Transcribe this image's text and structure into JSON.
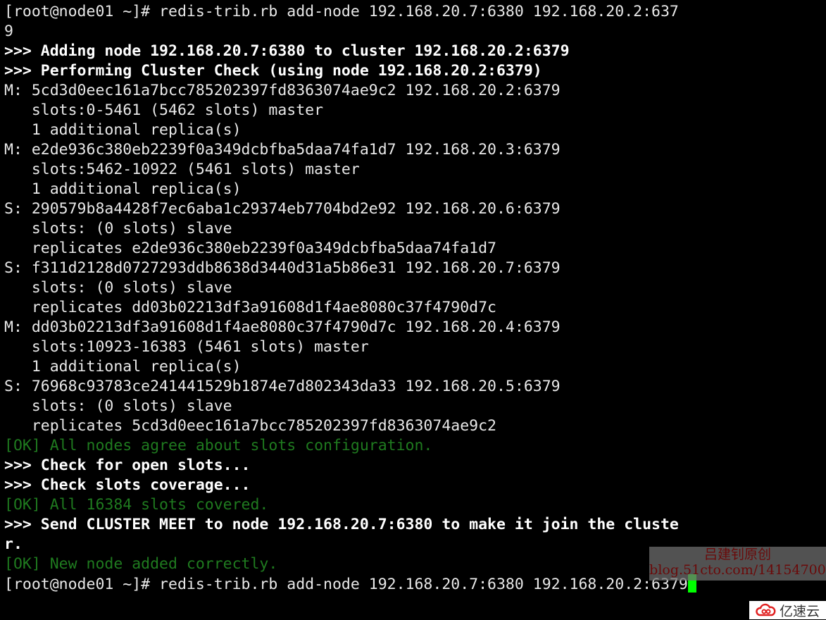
{
  "terminal": {
    "lines": [
      {
        "text": "[root@node01 ~]# redis-trib.rb add-node 192.168.20.7:6380 192.168.20.2:637",
        "style": "normal"
      },
      {
        "text": "9",
        "style": "normal"
      },
      {
        "text": ">>> Adding node 192.168.20.7:6380 to cluster 192.168.20.2:6379",
        "style": "bold"
      },
      {
        "text": ">>> Performing Cluster Check (using node 192.168.20.2:6379)",
        "style": "bold"
      },
      {
        "text": "M: 5cd3d0eec161a7bcc785202397fd8363074ae9c2 192.168.20.2:6379",
        "style": "normal"
      },
      {
        "text": "   slots:0-5461 (5462 slots) master",
        "style": "normal"
      },
      {
        "text": "   1 additional replica(s)",
        "style": "normal"
      },
      {
        "text": "M: e2de936c380eb2239f0a349dcbfba5daa74fa1d7 192.168.20.3:6379",
        "style": "normal"
      },
      {
        "text": "   slots:5462-10922 (5461 slots) master",
        "style": "normal"
      },
      {
        "text": "   1 additional replica(s)",
        "style": "normal"
      },
      {
        "text": "S: 290579b8a4428f7ec6aba1c29374eb7704bd2e92 192.168.20.6:6379",
        "style": "normal"
      },
      {
        "text": "   slots: (0 slots) slave",
        "style": "normal"
      },
      {
        "text": "   replicates e2de936c380eb2239f0a349dcbfba5daa74fa1d7",
        "style": "normal"
      },
      {
        "text": "S: f311d2128d0727293ddb8638d3440d31a5b86e31 192.168.20.7:6379",
        "style": "normal"
      },
      {
        "text": "   slots: (0 slots) slave",
        "style": "normal"
      },
      {
        "text": "   replicates dd03b02213df3a91608d1f4ae8080c37f4790d7c",
        "style": "normal"
      },
      {
        "text": "M: dd03b02213df3a91608d1f4ae8080c37f4790d7c 192.168.20.4:6379",
        "style": "normal"
      },
      {
        "text": "   slots:10923-16383 (5461 slots) master",
        "style": "normal"
      },
      {
        "text": "   1 additional replica(s)",
        "style": "normal"
      },
      {
        "text": "S: 76968c93783ce241441529b1874e7d802343da33 192.168.20.5:6379",
        "style": "normal"
      },
      {
        "text": "   slots: (0 slots) slave",
        "style": "normal"
      },
      {
        "text": "   replicates 5cd3d0eec161a7bcc785202397fd8363074ae9c2",
        "style": "normal"
      },
      {
        "text": "[OK] All nodes agree about slots configuration.",
        "style": "ok"
      },
      {
        "text": ">>> Check for open slots...",
        "style": "bold"
      },
      {
        "text": ">>> Check slots coverage...",
        "style": "bold"
      },
      {
        "text": "[OK] All 16384 slots covered.",
        "style": "ok"
      },
      {
        "text": ">>> Send CLUSTER MEET to node 192.168.20.7:6380 to make it join the cluste",
        "style": "bold"
      },
      {
        "text": "r.",
        "style": "bold"
      },
      {
        "text": "[OK] New node added correctly.",
        "style": "ok"
      }
    ],
    "prompt_line": "[root@node01 ~]# redis-trib.rb add-node 192.168.20.7:6380 192.168.20.2:6379",
    "cursor_color": "#00ff00"
  },
  "watermark": {
    "line1": "吕建钊原创",
    "line2": "blog.51cto.com/14154700"
  },
  "logo": {
    "text": "亿速云",
    "icon": "cloud-icon",
    "color": "#e02020"
  }
}
